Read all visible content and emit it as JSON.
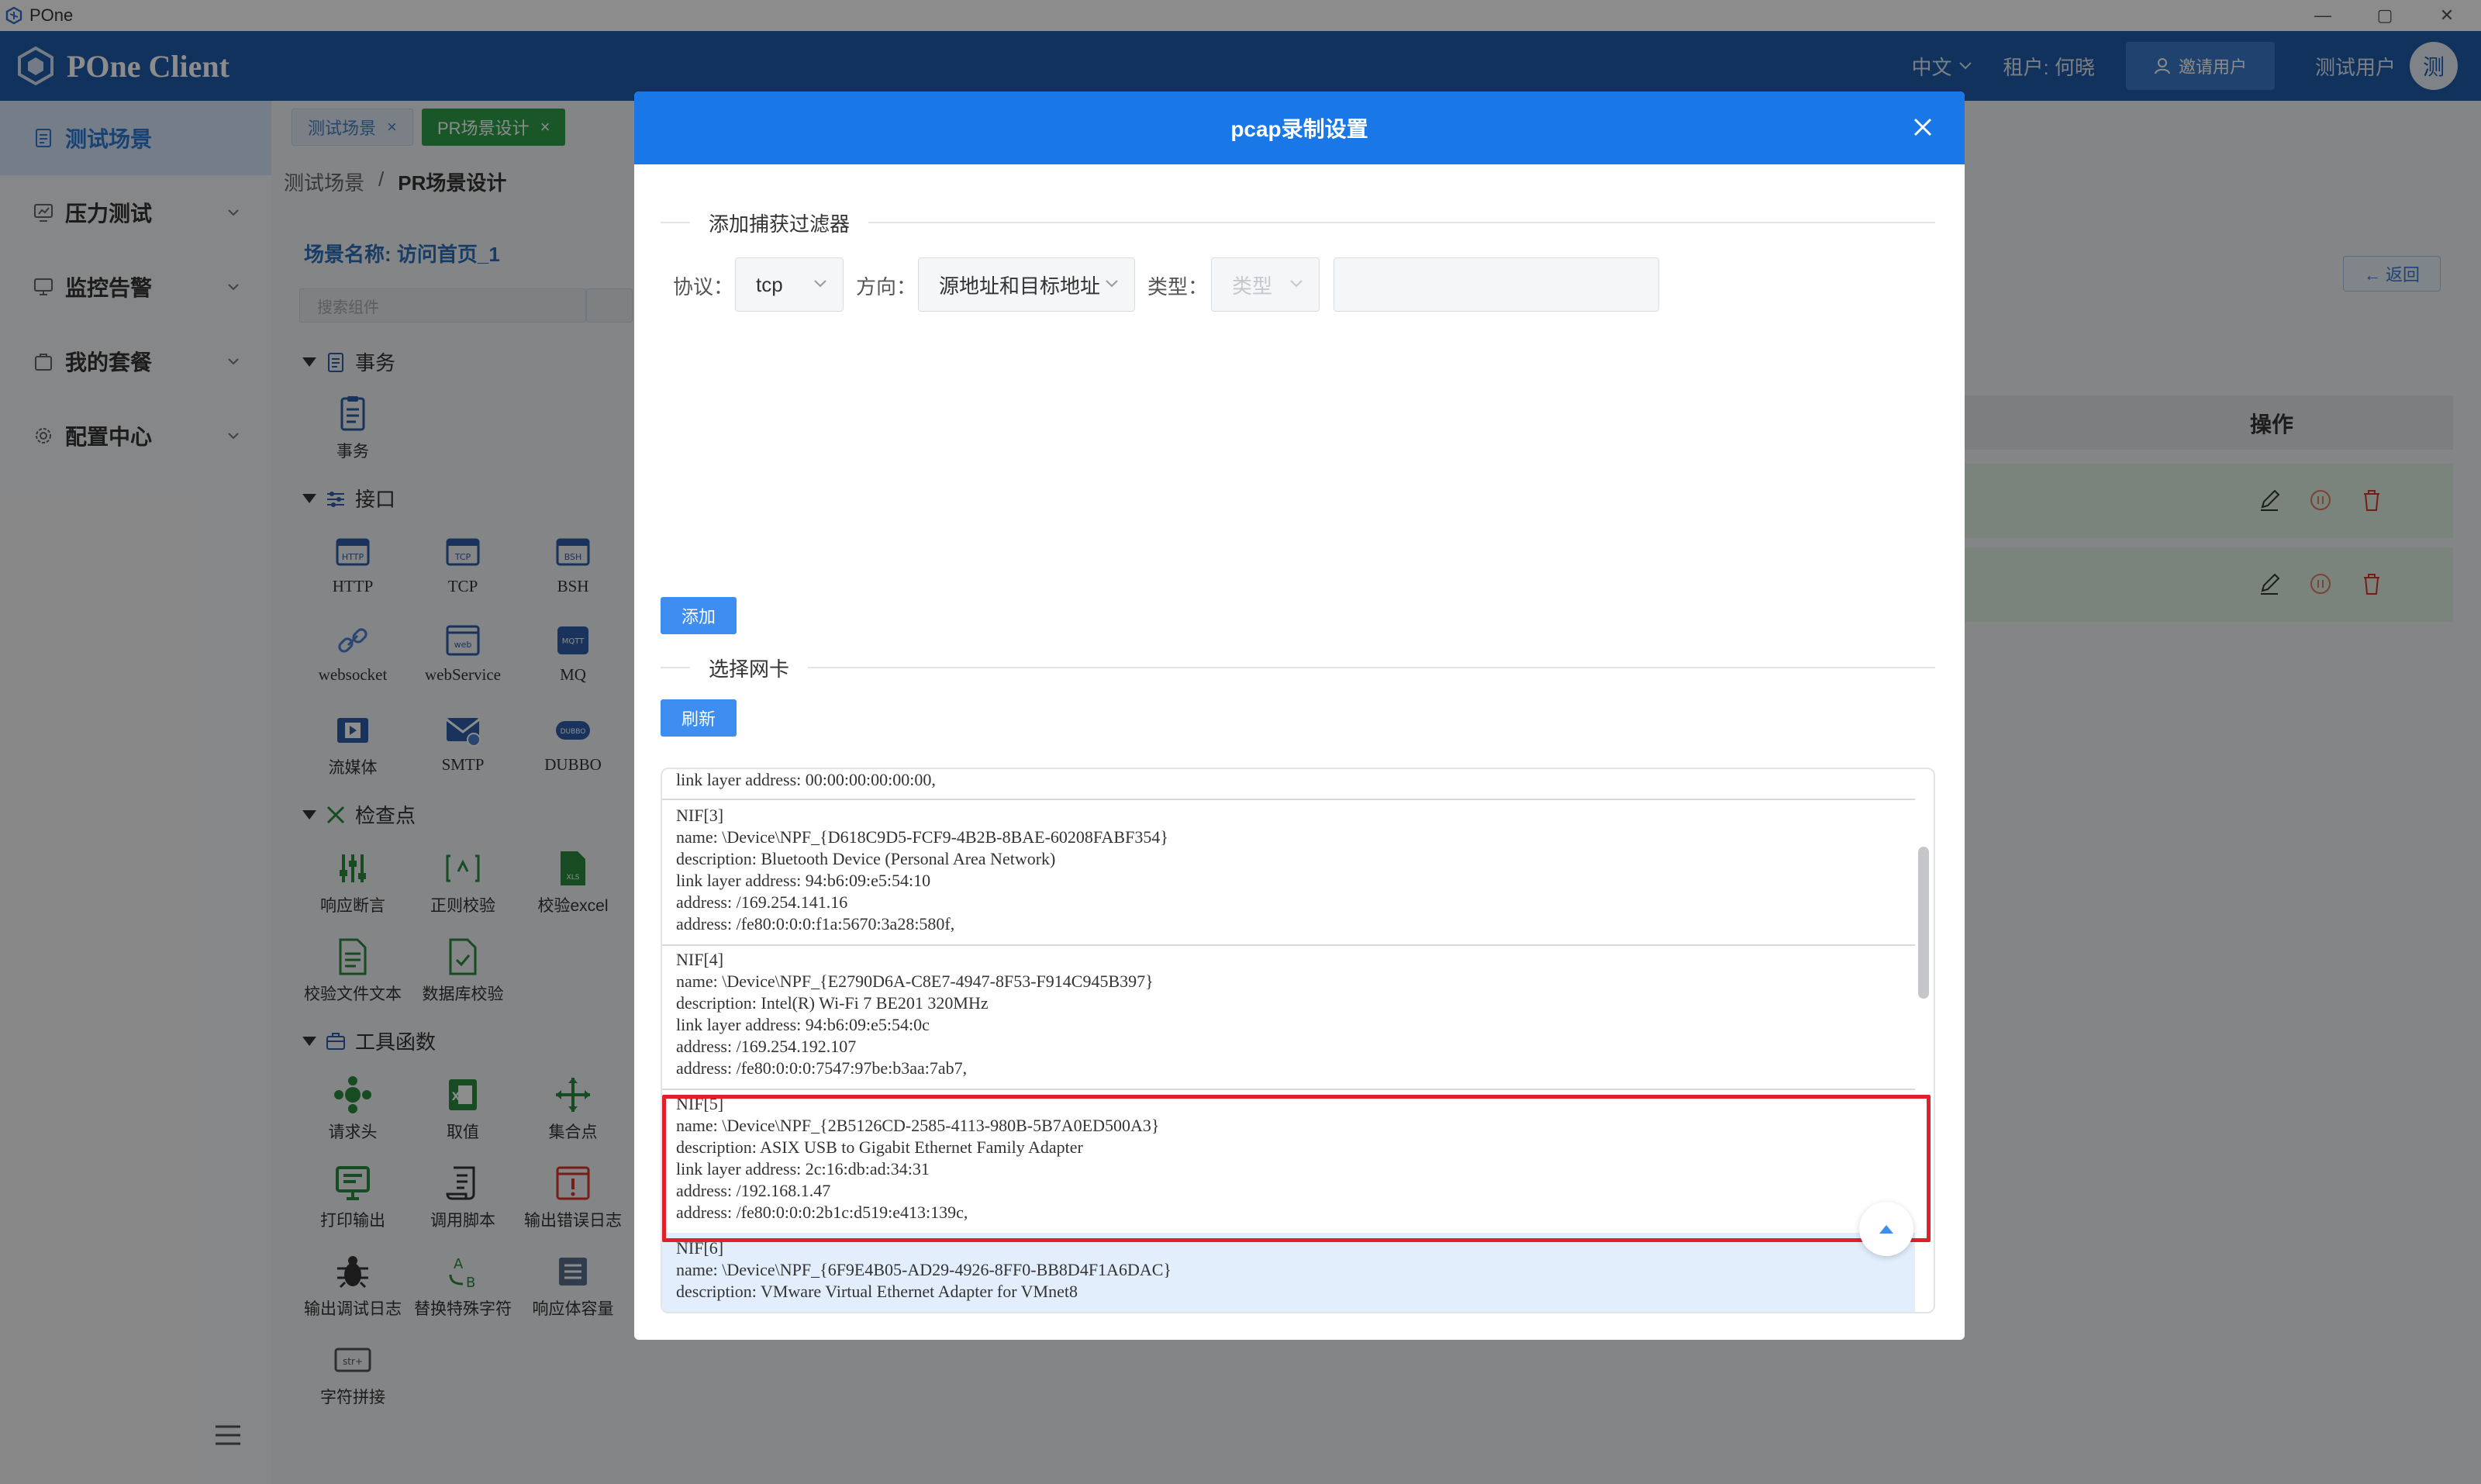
{
  "window": {
    "title": "POne",
    "controls": [
      "—",
      "▢",
      "✕"
    ]
  },
  "header": {
    "brand": "POne Client",
    "language": "中文",
    "tenant": "租户: 何晓",
    "invite_button": "邀请用户",
    "user": "测试用户",
    "avatar_text": "测"
  },
  "sidebar": {
    "items": [
      {
        "label": "测试场景",
        "icon": "document-icon",
        "active": true
      },
      {
        "label": "压力测试",
        "icon": "chart-icon",
        "active": false
      },
      {
        "label": "监控告警",
        "icon": "monitor-icon",
        "active": false
      },
      {
        "label": "我的套餐",
        "icon": "bag-icon",
        "active": false
      },
      {
        "label": "配置中心",
        "icon": "gear-icon",
        "active": false
      }
    ]
  },
  "tabs": [
    {
      "label": "测试场景",
      "close": "×",
      "active": false
    },
    {
      "label": "PR场景设计",
      "close": "×",
      "active": true
    }
  ],
  "breadcrumb": {
    "root": "测试场景",
    "separator": "/",
    "current": "PR场景设计"
  },
  "scene": {
    "name": "场景名称: 访问首页_1",
    "search_placeholder": "搜索组件"
  },
  "components": {
    "transaction": {
      "title": "事务",
      "items": [
        "事务"
      ]
    },
    "interface": {
      "title": "接口",
      "items": [
        "HTTP",
        "TCP",
        "BSH",
        "websocket",
        "webService",
        "MQ",
        "流媒体",
        "SMTP",
        "DUBBO"
      ]
    },
    "checkpoint": {
      "title": "检查点",
      "items": [
        "响应断言",
        "正则校验",
        "校验excel",
        "校验文件文本",
        "数据库校验"
      ]
    },
    "tools": {
      "title": "工具函数",
      "items": [
        "请求头",
        "取值",
        "集合点",
        "打印输出",
        "调用脚本",
        "输出错误日志",
        "输出调试日志",
        "替换特殊字符",
        "响应体容量",
        "字符拼接"
      ]
    }
  },
  "right_panel": {
    "back_button": "← 返回",
    "column_header": "操作"
  },
  "modal": {
    "title": "pcap录制设置",
    "filter_section": "添加捕获过滤器",
    "protocol_label": "协议：",
    "protocol_value": "tcp",
    "direction_label": "方向：",
    "direction_value": "源地址和目标地址",
    "type_label": "类型：",
    "type_placeholder": "类型",
    "add_button": "添加",
    "nic_section": "选择网卡",
    "refresh_button": "刷新",
    "nics": [
      {
        "lines": [
          "link layer address: 00:00:00:00:00:00,"
        ]
      },
      {
        "lines": [
          "NIF[3]",
          "name: \\Device\\NPF_{D618C9D5-FCF9-4B2B-8BAE-60208FABF354}",
          "description: Bluetooth Device (Personal Area Network)",
          "link layer address: 94:b6:09:e5:54:10",
          "address: /169.254.141.16",
          "address: /fe80:0:0:0:f1a:5670:3a28:580f,"
        ]
      },
      {
        "lines": [
          "NIF[4]",
          "name: \\Device\\NPF_{E2790D6A-C8E7-4947-8F53-F914C945B397}",
          "description: Intel(R) Wi-Fi 7 BE201 320MHz",
          "link layer address: 94:b6:09:e5:54:0c",
          "address: /169.254.192.107",
          "address: /fe80:0:0:0:7547:97be:b3aa:7ab7,"
        ]
      },
      {
        "lines": [
          "NIF[5]",
          "name: \\Device\\NPF_{2B5126CD-2585-4113-980B-5B7A0ED500A3}",
          "description: ASIX USB to Gigabit Ethernet Family Adapter",
          "link layer address: 2c:16:db:ad:34:31",
          "address: /192.168.1.47",
          "address: /fe80:0:0:0:2b1c:d519:e413:139c,"
        ]
      },
      {
        "lines": [
          "NIF[6]",
          "name: \\Device\\NPF_{6F9E4B05-AD29-4926-8FF0-BB8D4F1A6DAC}",
          "description: VMware Virtual Ethernet Adapter for VMnet8"
        ]
      }
    ]
  },
  "colors": {
    "header": "#1f5ba8",
    "modal_header": "#1977e8",
    "primary": "#3d8ef0",
    "highlight": "#e0202a"
  }
}
